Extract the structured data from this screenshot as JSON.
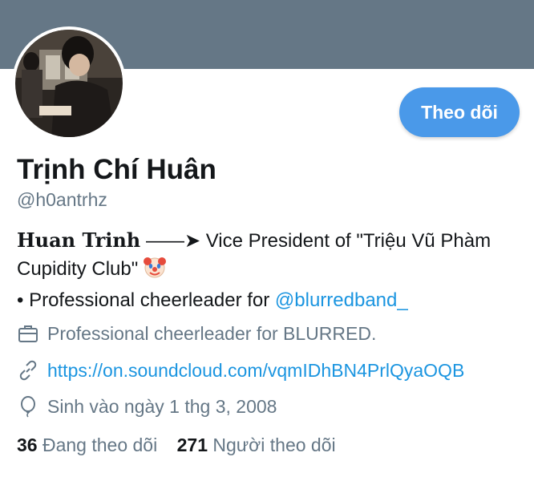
{
  "profile": {
    "name": "Trịnh Chí Huân",
    "handle": "@h0antrhz",
    "follow_label": "Theo dõi",
    "bio": {
      "styled_name": "Huan Trinh",
      "arrow": "——➤",
      "line1_rest": "Vice President of \"Triệu Vũ Phàm Cupidity Club\"",
      "line2_prefix": "• Professional cheerleader for",
      "mention": "@blurredband_"
    },
    "work": "Professional cheerleader for BLURRED.",
    "url": "https://on.soundcloud.com/vqmIDhBN4PrlQyaOQB",
    "birthday": "Sinh vào ngày 1 thg 3, 2008",
    "following_count": "36",
    "following_label": "Đang theo dõi",
    "followers_count": "271",
    "followers_label": "Người theo dõi"
  },
  "colors": {
    "banner": "#657786",
    "accent": "#4a99e9",
    "link": "#1b95e0",
    "secondary_text": "#657786"
  },
  "icons": [
    "briefcase-icon",
    "link-icon",
    "balloon-icon",
    "clown-emoji-icon"
  ]
}
